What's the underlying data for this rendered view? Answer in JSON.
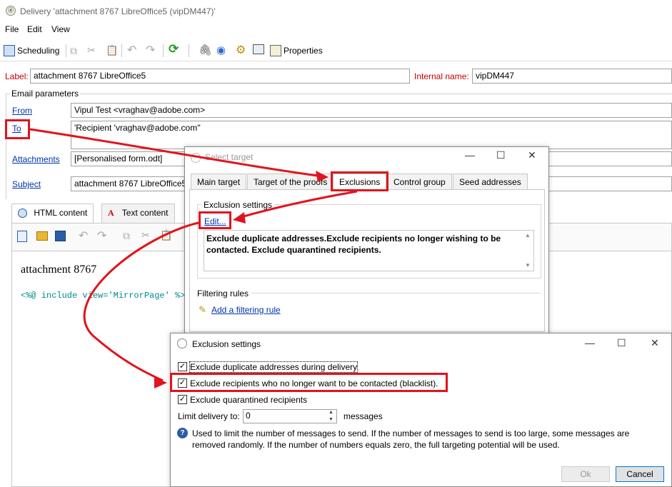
{
  "window": {
    "title": "Delivery 'attachment 8767 LibreOffice5 (vipDM447)'"
  },
  "menu": {
    "file": "File",
    "edit": "Edit",
    "view": "View"
  },
  "toolbar": {
    "scheduling": "Scheduling",
    "properties": "Properties"
  },
  "form": {
    "label_caption": "Label:",
    "label_value": "attachment 8767 LibreOffice5",
    "internal_name_caption": "Internal name:",
    "internal_name_value": "vipDM447",
    "email_params": "Email parameters",
    "from_caption": "From",
    "from_value": "Vipul Test <vraghav@adobe.com>",
    "to_caption": "To",
    "to_value": "'Recipient 'vraghav@adobe.com''",
    "attachments_caption": "Attachments",
    "attachments_value": "[Personalised form.odt]",
    "subject_caption": "Subject",
    "subject_value": "attachment 8767 LibreOffice5"
  },
  "content_tabs": {
    "html": "HTML content",
    "text": "Text content"
  },
  "editor": {
    "heading": "attachment 8767",
    "code": "<%@ include view='MirrorPage' %>"
  },
  "select_target": {
    "title": "Select target",
    "tabs": [
      "Main target",
      "Target of the proofs",
      "Exclusions",
      "Control group",
      "Seed addresses"
    ],
    "exclusion_settings": "Exclusion settings",
    "edit_link": "Edit...",
    "summary": "Exclude duplicate addresses.Exclude recipients no longer wishing to be contacted. Exclude quarantined recipients.",
    "filtering_rules": "Filtering rules",
    "add_rule": "Add a filtering rule"
  },
  "exclusion_dialog": {
    "title": "Exclusion settings",
    "opt1": "Exclude duplicate addresses during delivery",
    "opt2": "Exclude recipients who no longer want to be contacted (blacklist).",
    "opt3": "Exclude quarantined recipients",
    "limit_label": "Limit delivery to:",
    "limit_value": "0",
    "limit_unit": "messages",
    "help": "Used to limit the number of messages to send. If the number of messages to send is too large, some messages are removed randomly. If the number of numbers equals zero, the full targeting potential will be used.",
    "ok": "Ok",
    "cancel": "Cancel"
  },
  "colors": {
    "highlight": "#e0141e",
    "link": "#0033aa",
    "label_red": "#c00000"
  }
}
